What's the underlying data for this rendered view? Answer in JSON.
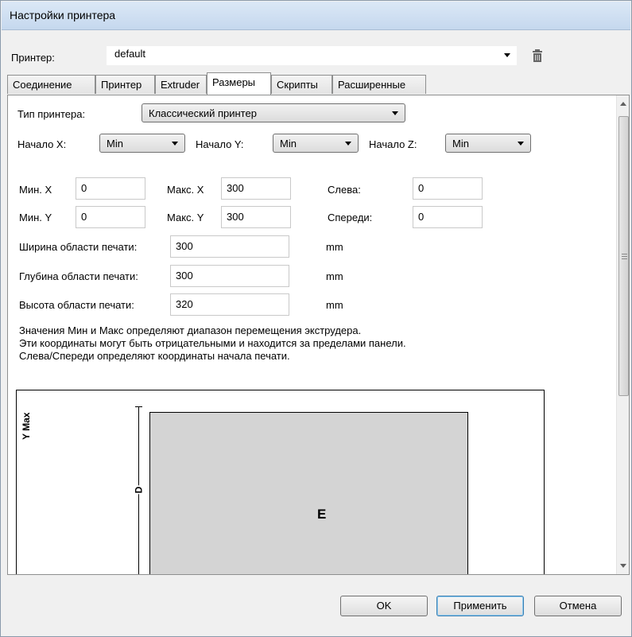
{
  "window": {
    "title": "Настройки принтера"
  },
  "printer": {
    "label": "Принтер:",
    "value": "default"
  },
  "tabs": [
    {
      "label": "Соединение"
    },
    {
      "label": "Принтер"
    },
    {
      "label": "Extruder"
    },
    {
      "label": "Размеры",
      "active": true
    },
    {
      "label": "Скрипты"
    },
    {
      "label": "Расширенные"
    }
  ],
  "dimensions": {
    "printer_type_label": "Тип принтера:",
    "printer_type_value": "Классический принтер",
    "home_x_label": "Начало X:",
    "home_x_value": "Min",
    "home_y_label": "Начало Y:",
    "home_y_value": "Min",
    "home_z_label": "Начало Z:",
    "home_z_value": "Min",
    "min_x_label": "Мин. X",
    "min_x_value": "0",
    "max_x_label": "Макс. X",
    "max_x_value": "300",
    "left_label": "Слева:",
    "left_value": "0",
    "min_y_label": "Мин. Y",
    "min_y_value": "0",
    "max_y_label": "Макс. Y",
    "max_y_value": "300",
    "front_label": "Спереди:",
    "front_value": "0",
    "width_label": "Ширина области печати:",
    "width_value": "300",
    "width_unit": "mm",
    "depth_label": "Глубина области печати:",
    "depth_value": "300",
    "depth_unit": "mm",
    "height_label": "Высота области печати:",
    "height_value": "320",
    "height_unit": "mm",
    "note_1": "Значения Мин и Макс определяют диапазон перемещения экструдера.",
    "note_2": "Эти координаты могут быть отрицательными и находится за пределами панели.",
    "note_3": "Слева/Спереди определяют координаты начала печати."
  },
  "diagram": {
    "y_max": "Y Max",
    "d": "D",
    "e": "E"
  },
  "buttons": {
    "ok": "OK",
    "apply": "Применить",
    "cancel": "Отмена"
  },
  "icons": {
    "delete": "trash-icon",
    "scroll": "scrollbar-grip-icon"
  },
  "colors": {
    "titlebar": "#c5d8ee",
    "bed": "#d4d4d4",
    "window_bg": "#f0f0f0"
  }
}
